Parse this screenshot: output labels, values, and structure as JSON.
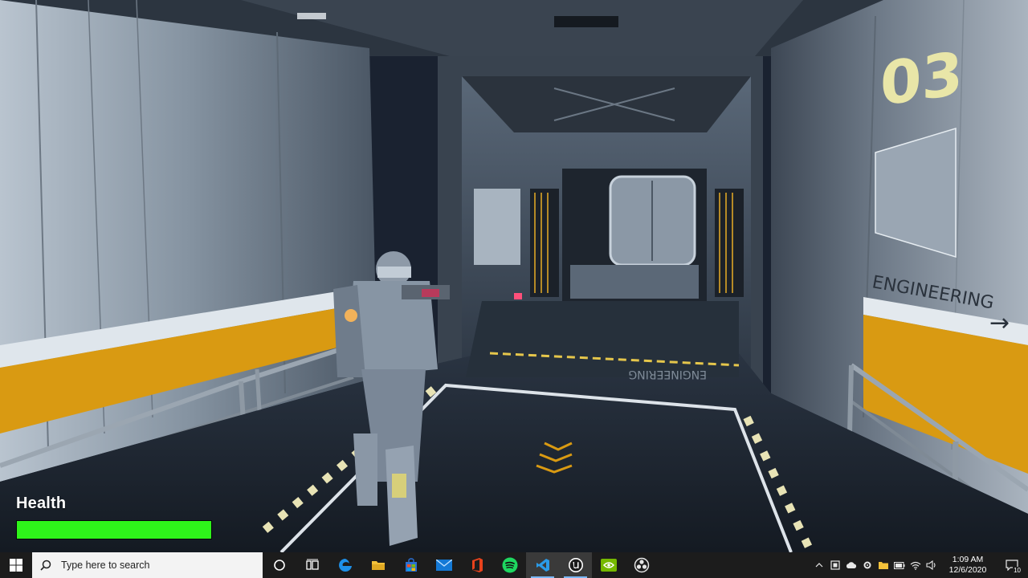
{
  "game": {
    "hud": {
      "health_label": "Health",
      "health_fraction": 1.0,
      "health_color": "#2ef41a"
    },
    "scene": {
      "wall_number": "03",
      "wall_sign": "ENGINEERING",
      "floor_sign": "ENGINEERING",
      "accent_stripe_color": "#d99a12"
    }
  },
  "taskbar": {
    "search_placeholder": "Type here to search",
    "pinned": [
      {
        "name": "cortana",
        "icon": "circle-icon"
      },
      {
        "name": "task-view",
        "icon": "task-view-icon"
      },
      {
        "name": "edge",
        "icon": "edge-icon"
      },
      {
        "name": "file-explorer",
        "icon": "folder-icon"
      },
      {
        "name": "store",
        "icon": "store-bag-icon"
      },
      {
        "name": "mail",
        "icon": "mail-icon"
      },
      {
        "name": "office",
        "icon": "office-icon"
      },
      {
        "name": "spotify",
        "icon": "spotify-icon"
      },
      {
        "name": "vscode",
        "icon": "vscode-icon",
        "active": true
      },
      {
        "name": "unreal-engine",
        "icon": "unreal-icon",
        "active": true
      },
      {
        "name": "nvidia",
        "icon": "nvidia-icon"
      },
      {
        "name": "obs",
        "icon": "obs-icon"
      }
    ],
    "clock": {
      "time": "1:09 AM",
      "date": "12/6/2020"
    },
    "notification_count": "10"
  }
}
